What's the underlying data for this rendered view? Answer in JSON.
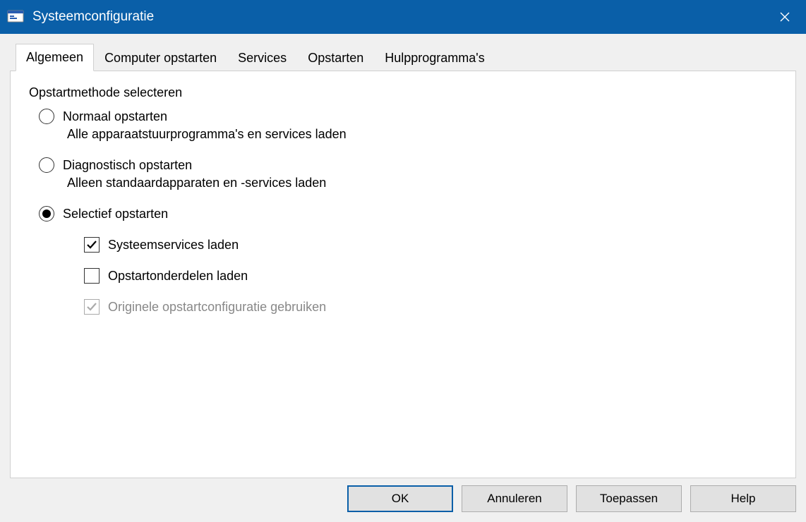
{
  "window": {
    "title": "Systeemconfiguratie"
  },
  "tabs": [
    {
      "label": "Algemeen",
      "active": true
    },
    {
      "label": "Computer opstarten",
      "active": false
    },
    {
      "label": "Services",
      "active": false
    },
    {
      "label": "Opstarten",
      "active": false
    },
    {
      "label": "Hulpprogramma's",
      "active": false
    }
  ],
  "group": {
    "title": "Opstartmethode selecteren",
    "options": [
      {
        "label": "Normaal opstarten",
        "desc": "Alle apparaatstuurprogramma's en services laden",
        "selected": false
      },
      {
        "label": "Diagnostisch opstarten",
        "desc": "Alleen standaardapparaten en -services laden",
        "selected": false
      },
      {
        "label": "Selectief opstarten",
        "desc": "",
        "selected": true
      }
    ],
    "sub": [
      {
        "label": "Systeemservices laden",
        "checked": true,
        "disabled": false
      },
      {
        "label": "Opstartonderdelen laden",
        "checked": false,
        "disabled": false
      },
      {
        "label": "Originele opstartconfiguratie gebruiken",
        "checked": true,
        "disabled": true
      }
    ]
  },
  "buttons": {
    "ok": "OK",
    "cancel": "Annuleren",
    "apply": "Toepassen",
    "help": "Help"
  }
}
